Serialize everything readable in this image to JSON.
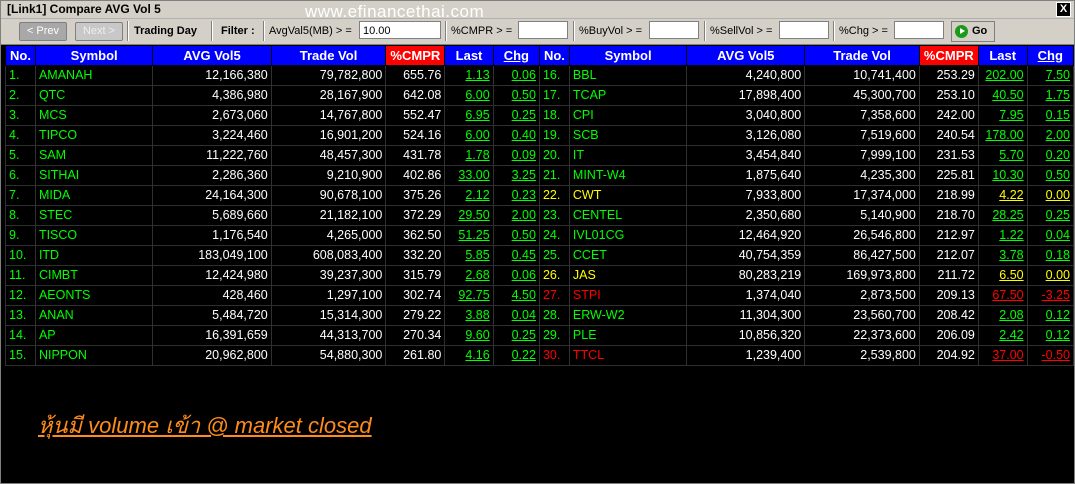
{
  "window": {
    "title": "[Link1] Compare AVG Vol 5",
    "close_label": "X"
  },
  "watermark": "www.efinancethai.com",
  "toolbar": {
    "prev_label": "< Prev",
    "next_label": "Next >",
    "trading_day_label": "Trading Day",
    "filter_label": "Filter :",
    "avgvol_label": "AvgVal5(MB) > =",
    "avgvol_value": "10.00",
    "cmpr_label": "%CMPR > =",
    "cmpr_value": "",
    "buyvol_label": "%BuyVol > =",
    "buyvol_value": "",
    "sellvol_label": "%SellVol > =",
    "sellvol_value": "",
    "chg_label": "%Chg > =",
    "chg_value": "",
    "go_label": "Go"
  },
  "headers": [
    "No.",
    "Symbol",
    "AVG Vol5",
    "Trade Vol",
    "%CMPR",
    "Last",
    "Chg"
  ],
  "colors": {
    "up": "#00ff00",
    "unchanged": "#ffff00",
    "down": "#ff0000",
    "header": "#0000ff",
    "cmpr_header": "#ff0000"
  },
  "left_rows": [
    {
      "no": "1.",
      "sym": "AMANAH",
      "avg": "12,166,380",
      "vol": "79,782,800",
      "cmpr": "655.76",
      "last": "1.13",
      "chg": "0.06",
      "c": "g"
    },
    {
      "no": "2.",
      "sym": "QTC",
      "avg": "4,386,980",
      "vol": "28,167,900",
      "cmpr": "642.08",
      "last": "6.00",
      "chg": "0.50",
      "c": "g"
    },
    {
      "no": "3.",
      "sym": "MCS",
      "avg": "2,673,060",
      "vol": "14,767,800",
      "cmpr": "552.47",
      "last": "6.95",
      "chg": "0.25",
      "c": "g"
    },
    {
      "no": "4.",
      "sym": "TIPCO",
      "avg": "3,224,460",
      "vol": "16,901,200",
      "cmpr": "524.16",
      "last": "6.00",
      "chg": "0.40",
      "c": "g"
    },
    {
      "no": "5.",
      "sym": "SAM",
      "avg": "11,222,760",
      "vol": "48,457,300",
      "cmpr": "431.78",
      "last": "1.78",
      "chg": "0.09",
      "c": "g"
    },
    {
      "no": "6.",
      "sym": "SITHAI",
      "avg": "2,286,360",
      "vol": "9,210,900",
      "cmpr": "402.86",
      "last": "33.00",
      "chg": "3.25",
      "c": "g"
    },
    {
      "no": "7.",
      "sym": "MIDA",
      "avg": "24,164,300",
      "vol": "90,678,100",
      "cmpr": "375.26",
      "last": "2.12",
      "chg": "0.23",
      "c": "g"
    },
    {
      "no": "8.",
      "sym": "STEC",
      "avg": "5,689,660",
      "vol": "21,182,100",
      "cmpr": "372.29",
      "last": "29.50",
      "chg": "2.00",
      "c": "g"
    },
    {
      "no": "9.",
      "sym": "TISCO",
      "avg": "1,176,540",
      "vol": "4,265,000",
      "cmpr": "362.50",
      "last": "51.25",
      "chg": "0.50",
      "c": "g"
    },
    {
      "no": "10.",
      "sym": "ITD",
      "avg": "183,049,100",
      "vol": "608,083,400",
      "cmpr": "332.20",
      "last": "5.85",
      "chg": "0.45",
      "c": "g"
    },
    {
      "no": "11.",
      "sym": "CIMBT",
      "avg": "12,424,980",
      "vol": "39,237,300",
      "cmpr": "315.79",
      "last": "2.68",
      "chg": "0.06",
      "c": "g"
    },
    {
      "no": "12.",
      "sym": "AEONTS",
      "avg": "428,460",
      "vol": "1,297,100",
      "cmpr": "302.74",
      "last": "92.75",
      "chg": "4.50",
      "c": "g"
    },
    {
      "no": "13.",
      "sym": "ANAN",
      "avg": "5,484,720",
      "vol": "15,314,300",
      "cmpr": "279.22",
      "last": "3.88",
      "chg": "0.04",
      "c": "g"
    },
    {
      "no": "14.",
      "sym": "AP",
      "avg": "16,391,659",
      "vol": "44,313,700",
      "cmpr": "270.34",
      "last": "9.60",
      "chg": "0.25",
      "c": "g"
    },
    {
      "no": "15.",
      "sym": "NIPPON",
      "avg": "20,962,800",
      "vol": "54,880,300",
      "cmpr": "261.80",
      "last": "4.16",
      "chg": "0.22",
      "c": "g"
    }
  ],
  "right_rows": [
    {
      "no": "16.",
      "sym": "BBL",
      "avg": "4,240,800",
      "vol": "10,741,400",
      "cmpr": "253.29",
      "last": "202.00",
      "chg": "7.50",
      "c": "g"
    },
    {
      "no": "17.",
      "sym": "TCAP",
      "avg": "17,898,400",
      "vol": "45,300,700",
      "cmpr": "253.10",
      "last": "40.50",
      "chg": "1.75",
      "c": "g"
    },
    {
      "no": "18.",
      "sym": "CPI",
      "avg": "3,040,800",
      "vol": "7,358,600",
      "cmpr": "242.00",
      "last": "7.95",
      "chg": "0.15",
      "c": "g"
    },
    {
      "no": "19.",
      "sym": "SCB",
      "avg": "3,126,080",
      "vol": "7,519,600",
      "cmpr": "240.54",
      "last": "178.00",
      "chg": "2.00",
      "c": "g"
    },
    {
      "no": "20.",
      "sym": "IT",
      "avg": "3,454,840",
      "vol": "7,999,100",
      "cmpr": "231.53",
      "last": "5.70",
      "chg": "0.20",
      "c": "g"
    },
    {
      "no": "21.",
      "sym": "MINT-W4",
      "avg": "1,875,640",
      "vol": "4,235,300",
      "cmpr": "225.81",
      "last": "10.30",
      "chg": "0.50",
      "c": "g"
    },
    {
      "no": "22.",
      "sym": "CWT",
      "avg": "7,933,800",
      "vol": "17,374,000",
      "cmpr": "218.99",
      "last": "4.22",
      "chg": "0.00",
      "c": "y"
    },
    {
      "no": "23.",
      "sym": "CENTEL",
      "avg": "2,350,680",
      "vol": "5,140,900",
      "cmpr": "218.70",
      "last": "28.25",
      "chg": "0.25",
      "c": "g"
    },
    {
      "no": "24.",
      "sym": "IVL01CG",
      "avg": "12,464,920",
      "vol": "26,546,800",
      "cmpr": "212.97",
      "last": "1.22",
      "chg": "0.04",
      "c": "g"
    },
    {
      "no": "25.",
      "sym": "CCET",
      "avg": "40,754,359",
      "vol": "86,427,500",
      "cmpr": "212.07",
      "last": "3.78",
      "chg": "0.18",
      "c": "g"
    },
    {
      "no": "26.",
      "sym": "JAS",
      "avg": "80,283,219",
      "vol": "169,973,800",
      "cmpr": "211.72",
      "last": "6.50",
      "chg": "0.00",
      "c": "y"
    },
    {
      "no": "27.",
      "sym": "STPI",
      "avg": "1,374,040",
      "vol": "2,873,500",
      "cmpr": "209.13",
      "last": "67.50",
      "chg": "-3.25",
      "c": "r"
    },
    {
      "no": "28.",
      "sym": "ERW-W2",
      "avg": "11,304,300",
      "vol": "23,560,700",
      "cmpr": "208.42",
      "last": "2.08",
      "chg": "0.12",
      "c": "g"
    },
    {
      "no": "29.",
      "sym": "PLE",
      "avg": "10,856,320",
      "vol": "22,373,600",
      "cmpr": "206.09",
      "last": "2.42",
      "chg": "0.12",
      "c": "g"
    },
    {
      "no": "30.",
      "sym": "TTCL",
      "avg": "1,239,400",
      "vol": "2,539,800",
      "cmpr": "204.92",
      "last": "37.00",
      "chg": "-0.50",
      "c": "r"
    }
  ],
  "note": "หุ้นมี volume เข้า @ market closed"
}
